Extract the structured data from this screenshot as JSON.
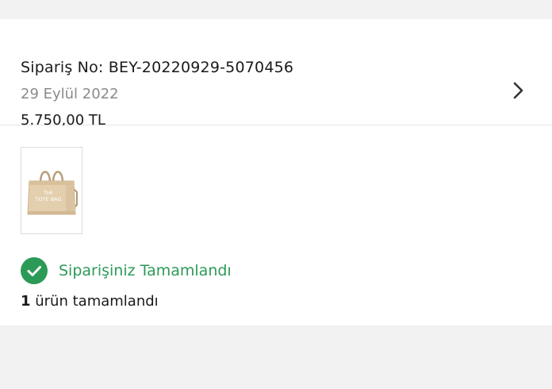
{
  "order": {
    "number": "Sipariş No: BEY-20220929-5070456",
    "date": "29 Eylül 2022",
    "total": "5.750,00 TL"
  },
  "item": {
    "bag_text_line1": "THE",
    "bag_text_line2": "TOTE BAG"
  },
  "status": {
    "text": "Siparişiniz Tamamlandı",
    "color": "#2c9a57",
    "icon": "check-circle-icon"
  },
  "summary": {
    "count": "1",
    "text": " ürün tamamlandı"
  },
  "icons": {
    "chevron": "chevron-right-icon"
  }
}
